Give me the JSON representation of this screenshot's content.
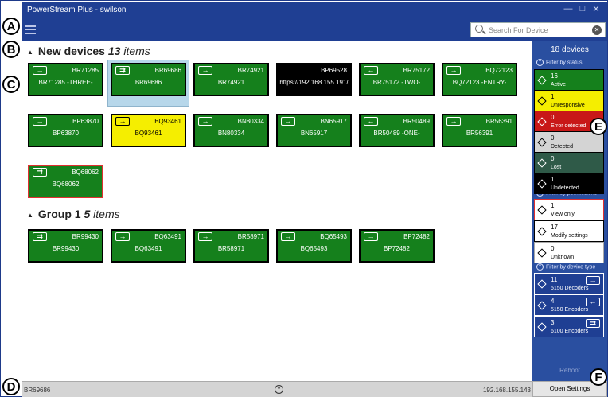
{
  "app": {
    "title": "PowerStream Plus - swilson",
    "min": "—",
    "max": "□",
    "close": "✕"
  },
  "search": {
    "placeholder": "Search For Device"
  },
  "groups": [
    {
      "name": "New devices",
      "count": "13",
      "items_label": "items"
    },
    {
      "name": "Group 1",
      "count": "5",
      "items_label": "items"
    }
  ],
  "devices": [
    {
      "id": "BR71285",
      "name": "BR71285 -THREE-",
      "color": "green",
      "icon": "decoder"
    },
    {
      "id": "BR69686",
      "name": "BR69686",
      "color": "green",
      "icon": "encoder-6100",
      "selected": true
    },
    {
      "id": "BR74921",
      "name": "BR74921",
      "color": "green",
      "icon": "decoder"
    },
    {
      "id": "BP69528",
      "name": "https://192.168.155.191/",
      "color": "black",
      "icon": ""
    },
    {
      "id": "BR75172",
      "name": "BR75172 -TWO-",
      "color": "green",
      "icon": "encoder"
    },
    {
      "id": "BQ72123",
      "name": "BQ72123 -ENTRY-",
      "color": "green",
      "icon": "decoder"
    },
    {
      "id": "BP63870",
      "name": "BP63870",
      "color": "green",
      "icon": "decoder"
    },
    {
      "id": "BQ93461",
      "name": "BQ93461",
      "color": "yellow",
      "icon": "decoder"
    },
    {
      "id": "BN80334",
      "name": "BN80334",
      "color": "green",
      "icon": "decoder"
    },
    {
      "id": "BN65917",
      "name": "BN65917",
      "color": "green",
      "icon": "decoder"
    },
    {
      "id": "BR50489",
      "name": "BR50489 -ONE-",
      "color": "green",
      "icon": "encoder"
    },
    {
      "id": "BR56391",
      "name": "BR56391",
      "color": "green",
      "icon": "decoder"
    },
    {
      "id": "BQ68062",
      "name": "BQ68062",
      "color": "green",
      "icon": "encoder-6100",
      "red": true
    },
    {
      "id": "BR99430",
      "name": "BR99430",
      "color": "green",
      "icon": "encoder-6100"
    },
    {
      "id": "BQ63491",
      "name": "BQ63491",
      "color": "green",
      "icon": "decoder"
    },
    {
      "id": "BR58971",
      "name": "BR58971",
      "color": "green",
      "icon": "decoder"
    },
    {
      "id": "BQ65493",
      "name": "BQ65493",
      "color": "green",
      "icon": "decoder"
    },
    {
      "id": "BP72482",
      "name": "BP72482",
      "color": "green",
      "icon": "decoder"
    }
  ],
  "sidebar": {
    "header": "18 devices",
    "filter_status": "Filter by status",
    "status": [
      {
        "n": "16",
        "l": "Active",
        "bg": "#15801c",
        "fg": "#fff"
      },
      {
        "n": "1",
        "l": "Unresponsive",
        "bg": "#f5ee00",
        "fg": "#000"
      },
      {
        "n": "0",
        "l": "Error detected",
        "bg": "#c81818",
        "fg": "#fff"
      },
      {
        "n": "0",
        "l": "Detected",
        "bg": "#d4d4d4",
        "fg": "#000"
      },
      {
        "n": "0",
        "l": "Lost",
        "bg": "#2f5a48",
        "fg": "#fff"
      },
      {
        "n": "1",
        "l": "Undetected",
        "bg": "#000",
        "fg": "#fff"
      }
    ],
    "filter_permissions": "Filter by permissions",
    "permissions": [
      {
        "n": "1",
        "l": "View only",
        "bg": "#fff",
        "fg": "#000",
        "border": "#e03030"
      },
      {
        "n": "17",
        "l": "Modify settings",
        "bg": "#fff",
        "fg": "#000",
        "border": "#000"
      },
      {
        "n": "0",
        "l": "Unknown",
        "bg": "#fff",
        "fg": "#000",
        "border": "#aaa"
      }
    ],
    "filter_type": "Filter by device type",
    "types": [
      {
        "n": "11",
        "l": "5150 Decoders",
        "icon": "→"
      },
      {
        "n": "4",
        "l": "5150 Encoders",
        "icon": "←"
      },
      {
        "n": "3",
        "l": "6100 Encoders",
        "icon": "⇉"
      }
    ],
    "reboot": "Reboot",
    "open_settings": "Open Settings"
  },
  "status": {
    "left": "BR69686",
    "right": "192.168.155.143"
  },
  "markers": [
    "A",
    "B",
    "C",
    "D",
    "E",
    "F"
  ]
}
